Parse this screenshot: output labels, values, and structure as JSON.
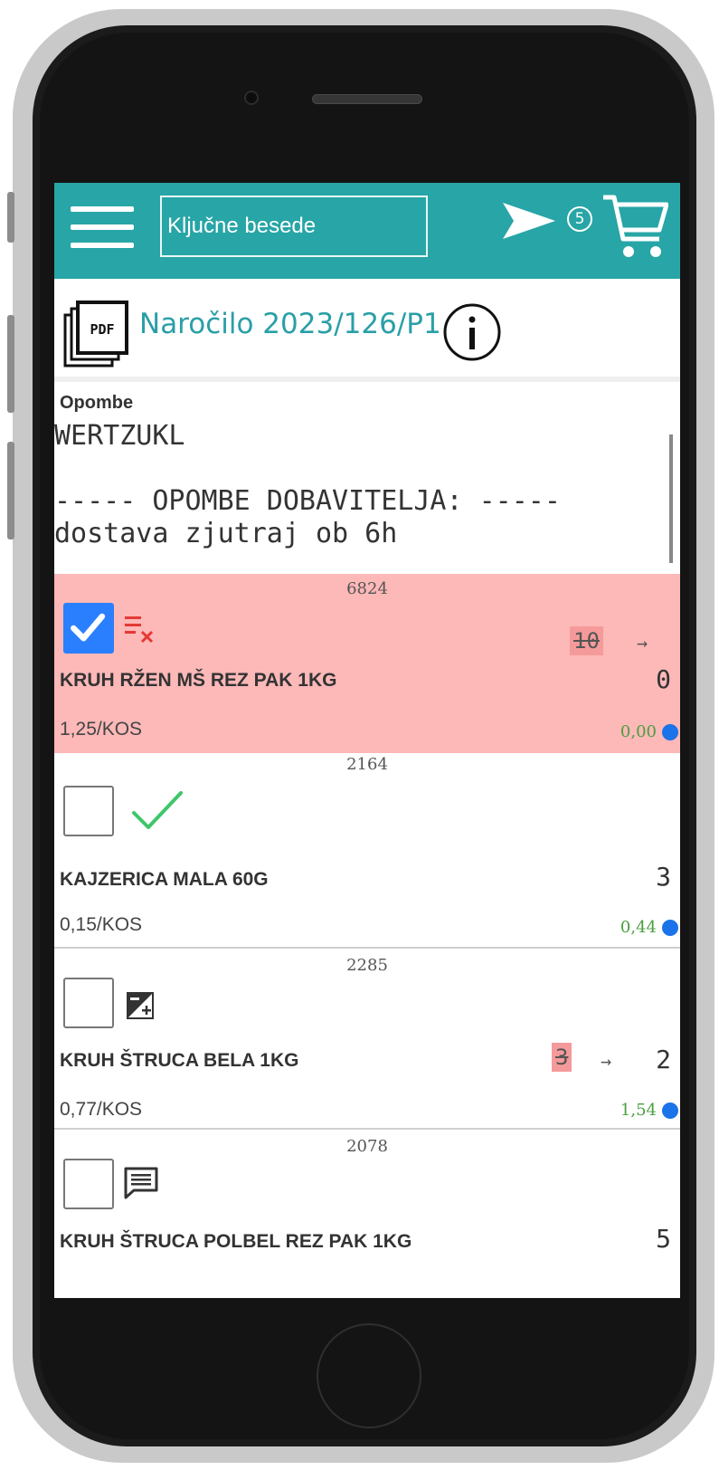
{
  "header": {
    "search_placeholder": "Ključne besede",
    "send_badge": "5"
  },
  "order": {
    "title": "Naročilo 2023/126/P1",
    "pdf_label": "PDF"
  },
  "notes": {
    "label": "Opombe",
    "text": "WERTZUKL\n\n----- OPOMBE DOBAVITELJA: -----\ndostava zjutraj ob 6h"
  },
  "items": [
    {
      "code": "6824",
      "checked": true,
      "status_icon": "remove-note-icon",
      "name": "KRUH RŽEN MŠ REZ PAK 1KG",
      "old_qty": "10",
      "qty": "0",
      "price": "1,25/KOS",
      "total": "0,00"
    },
    {
      "code": "2164",
      "checked": false,
      "status_icon": "checkmark-icon",
      "name": "KAJZERICA MALA 60G",
      "qty": "3",
      "price": "0,15/KOS",
      "total": "0,44"
    },
    {
      "code": "2285",
      "checked": false,
      "status_icon": "quantity-change-icon",
      "name": "KRUH ŠTRUCA BELA 1KG",
      "old_qty": "3",
      "qty": "2",
      "price": "0,77/KOS",
      "total": "1,54"
    },
    {
      "code": "2078",
      "checked": false,
      "status_icon": "comment-icon",
      "name": "KRUH ŠTRUCA POLBEL REZ PAK 1KG",
      "qty": "5"
    }
  ],
  "arrow_symbol": "→",
  "colors": {
    "header_bg": "#28a5a6",
    "title": "#2a9fa7",
    "selected_row": "#fdb8b8",
    "old_qty_bg": "#f59a9a",
    "total_text": "#4a9e3f",
    "dot": "#1a73e8"
  }
}
